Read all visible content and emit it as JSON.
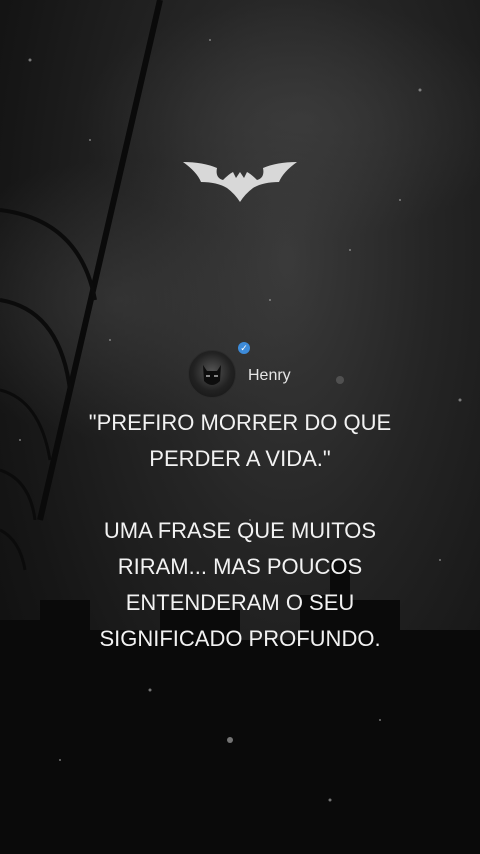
{
  "author": {
    "name": "Henry"
  },
  "quote": {
    "line1": "\"PREFIRO MORRER DO QUE",
    "line2": "PERDER A VIDA.\"",
    "line3": "UMA FRASE QUE MUITOS",
    "line4": "RIRAM... MAS POUCOS",
    "line5": "ENTENDERAM O SEU",
    "line6": "SIGNIFICADO PROFUNDO."
  },
  "icons": {
    "logo": "bat-symbol-icon",
    "badge": "verified-badge-icon",
    "avatar": "batman-avatar"
  },
  "colors": {
    "badge": "#3d8bd9",
    "text": "#f2f2f2"
  }
}
